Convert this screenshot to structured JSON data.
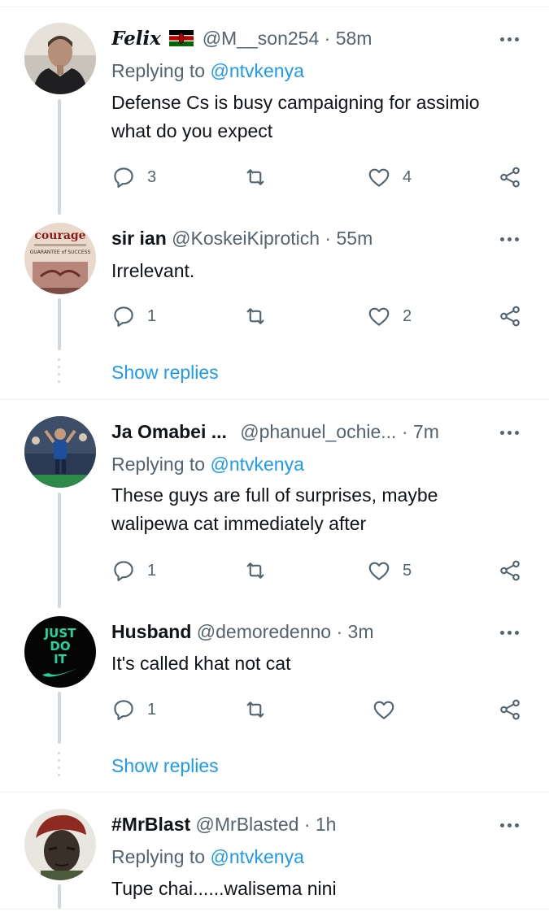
{
  "tweets": [
    {
      "name": "Felix",
      "handle": "@M__son254",
      "sep": "·",
      "time": "58m",
      "replying_prefix": "Replying to",
      "replying_to": "@ntvkenya",
      "text": "Defense Cs is busy campaigning for assimio what do you expect",
      "replies": "3",
      "retweets": "",
      "likes": "4",
      "avatar_icon": "man-portrait-avatar"
    },
    {
      "name": "sir ian",
      "handle": "@KoskeiKiprotich",
      "sep": "·",
      "time": "55m",
      "text": "Irrelevant.",
      "replies": "1",
      "retweets": "",
      "likes": "2",
      "avatar_icon": "courage-poster-avatar",
      "avatar_text": [
        "courage",
        "GUARANTEE of SUCCESS"
      ]
    },
    {
      "name": "Ja Omabei ...",
      "handle": "@phanuel_ochie...",
      "sep": "·",
      "time": "7m",
      "replying_prefix": "Replying to",
      "replying_to": "@ntvkenya",
      "text": "These guys are full of surprises, maybe walipewa  cat immediately after",
      "replies": "1",
      "retweets": "",
      "likes": "5",
      "avatar_icon": "football-player-avatar"
    },
    {
      "name": "Husband",
      "handle": "@demoredenno",
      "sep": "·",
      "time": "3m",
      "text": "It's called khat not cat",
      "replies": "1",
      "retweets": "",
      "likes": "",
      "avatar_icon": "just-do-it-avatar",
      "avatar_text": [
        "JUST",
        "DO",
        "IT"
      ]
    },
    {
      "name": "#MrBlast",
      "handle": "@MrBlasted",
      "sep": "·",
      "time": "1h",
      "replying_prefix": "Replying to",
      "replying_to": "@ntvkenya",
      "text": "Tupe chai......walisema nini",
      "avatar_icon": "soldier-avatar"
    }
  ],
  "show_replies": "Show replies",
  "colors": {
    "link": "#1d9bf0",
    "muted": "#536471",
    "divider": "#eff3f4"
  }
}
